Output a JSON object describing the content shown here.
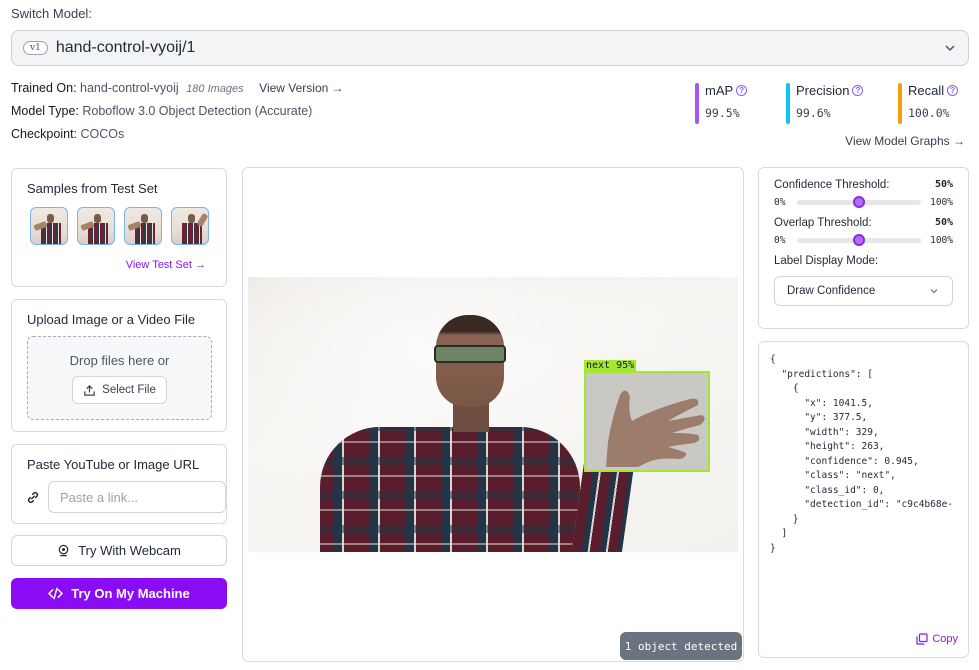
{
  "header": {
    "switch_label": "Switch Model:",
    "version_badge": "v1",
    "model_name": "hand-control-vyoij/1"
  },
  "info": {
    "trained_on_label": "Trained On:",
    "trained_on_value": "hand-control-vyoij",
    "image_count": "180 Images",
    "view_version": "View Version →",
    "model_type_label": "Model Type:",
    "model_type_value": "Roboflow 3.0 Object Detection (Accurate)",
    "checkpoint_label": "Checkpoint:",
    "checkpoint_value": "COCOs"
  },
  "metrics": [
    {
      "name": "mAP",
      "value": "99.5%",
      "color": "#a855f7"
    },
    {
      "name": "Precision",
      "value": "99.6%",
      "color": "#0ec5f5"
    },
    {
      "name": "Recall",
      "value": "100.0%",
      "color": "#f59e0b"
    }
  ],
  "view_model_graphs": "View Model Graphs →",
  "samples": {
    "title": "Samples from Test Set",
    "link": "View Test Set →",
    "count": 4
  },
  "upload": {
    "title": "Upload Image or a Video File",
    "drop_text": "Drop files here or",
    "select_file": "Select File"
  },
  "url": {
    "title": "Paste YouTube or Image URL",
    "placeholder": "Paste a link...",
    "value": ""
  },
  "buttons": {
    "webcam": "Try With Webcam",
    "machine": "Try On My Machine"
  },
  "detection": {
    "label": "next 95%",
    "status": "1 object detected",
    "box_color": "#a3e635"
  },
  "settings": {
    "confidence_label": "Confidence Threshold:",
    "confidence_value": "50%",
    "confidence_pct": 50,
    "overlap_label": "Overlap Threshold:",
    "overlap_value": "50%",
    "overlap_pct": 50,
    "min_label": "0%",
    "max_label": "100%",
    "label_mode_label": "Label Display Mode:",
    "label_mode_value": "Draw Confidence"
  },
  "json_output": "{\n  \"predictions\": [\n    {\n      \"x\": 1041.5,\n      \"y\": 377.5,\n      \"width\": 329,\n      \"height\": 263,\n      \"confidence\": 0.945,\n      \"class\": \"next\",\n      \"class_id\": 0,\n      \"detection_id\": \"c9c4b68e-\n    }\n  ]\n}",
  "copy_label": "Copy",
  "accent_color": "#8a0cf4"
}
